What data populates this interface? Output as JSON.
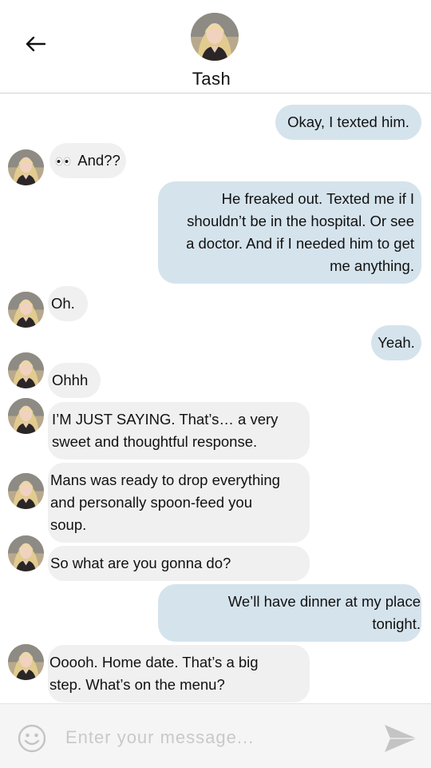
{
  "contact": {
    "name": "Tash"
  },
  "messages": [
    {
      "dir": "out",
      "text": "Okay, I texted him."
    },
    {
      "dir": "in",
      "text": "And??",
      "prefix_icon": "eyes-icon"
    },
    {
      "dir": "out",
      "lines": [
        "He freaked out. Texted me if I",
        "shouldn’t be in the hospital. Or see",
        "a doctor. And if I needed him to get",
        "me anything."
      ]
    },
    {
      "dir": "in",
      "text": "Oh."
    },
    {
      "dir": "out",
      "text": "Yeah."
    },
    {
      "dir": "in",
      "text": "Ohhh"
    },
    {
      "dir": "in",
      "lines": [
        "I’M JUST SAYING. That’s… a very",
        "sweet and thoughtful response."
      ]
    },
    {
      "dir": "in",
      "lines": [
        "Mans was ready to drop everything",
        "and personally spoon-feed you",
        "soup."
      ]
    },
    {
      "dir": "in",
      "text": "So what are you gonna do?"
    },
    {
      "dir": "out",
      "lines": [
        "We’ll have dinner at my place",
        "tonight."
      ]
    },
    {
      "dir": "in",
      "lines": [
        "Ooooh. Home date. That’s a big",
        "step. What’s on the menu?"
      ]
    }
  ],
  "composer": {
    "placeholder": "Enter your message..."
  },
  "icons": {
    "back": "arrow-left-icon",
    "emoji": "smiley-icon",
    "send": "send-arrow-icon"
  },
  "colors": {
    "incoming_bubble": "#f0f0f0",
    "outgoing_bubble": "#d5e3ec",
    "composer_background": "#f5f5f5",
    "placeholder": "#c9c9c9"
  }
}
